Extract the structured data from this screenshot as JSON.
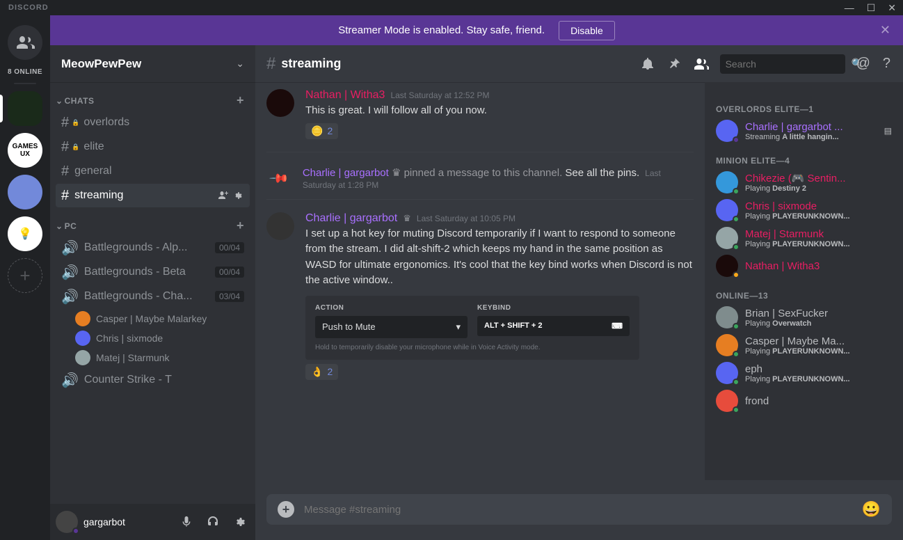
{
  "titlebar": {
    "brand": "DISCORD"
  },
  "guilds": {
    "online_label": "8 ONLINE"
  },
  "banner": {
    "text": "Streamer Mode is enabled. Stay safe, friend.",
    "button": "Disable"
  },
  "server": {
    "name": "MeowPewPew"
  },
  "categories": {
    "chats": {
      "label": "CHATS"
    },
    "pc": {
      "label": "PC"
    }
  },
  "channels": {
    "overlords": {
      "name": "overlords"
    },
    "elite": {
      "name": "elite"
    },
    "general": {
      "name": "general"
    },
    "streaming": {
      "name": "streaming"
    },
    "bg_alpha": {
      "name": "Battlegrounds - Alp...",
      "count": "00/04"
    },
    "bg_beta": {
      "name": "Battlegrounds - Beta",
      "count": "00/04"
    },
    "bg_cha": {
      "name": "Battlegrounds - Cha...",
      "count": "03/04"
    },
    "cs": {
      "name": "Counter Strike - T"
    }
  },
  "vc_users": [
    {
      "name": "Casper | Maybe Malarkey"
    },
    {
      "name": "Chris | sixmode"
    },
    {
      "name": "Matej | Starmunk"
    }
  ],
  "userbar": {
    "name": "gargarbot"
  },
  "topbar": {
    "channel": "streaming",
    "search_placeholder": "Search"
  },
  "messages": {
    "m1": {
      "author": "Nathan | Witha3",
      "ts": "Last Saturday at 12:52 PM",
      "text": "This is great. I will follow all of you now.",
      "react_emoji": "🪙",
      "react_count": "2"
    },
    "pin": {
      "author": "Charlie | gargarbot",
      "text": " pinned a message to this channel. ",
      "link": "See all the pins.",
      "ts": "Last Saturday at 1:28 PM"
    },
    "m2": {
      "author": "Charlie | gargarbot",
      "ts": "Last Saturday at 10:05 PM",
      "text": "I set up a hot key for muting Discord temporarily if I want to respond to someone from the stream. I did alt-shift-2 which keeps my hand in the same position as WASD for ultimate ergonomics. It's cool that the key bind works when Discord is not the active window..",
      "react_emoji": "👌",
      "react_count": "2"
    }
  },
  "embed": {
    "action_label": "ACTION",
    "action_value": "Push to Mute",
    "keybind_label": "KEYBIND",
    "keybind_value": "ALT + SHIFT + 2",
    "hint": "Hold to temporarily disable your microphone while in Voice Activity mode."
  },
  "composer": {
    "placeholder": "Message #streaming"
  },
  "roles": {
    "overlords": {
      "header": "OVERLORDS ELITE—1"
    },
    "minion": {
      "header": "MINION ELITE—4"
    },
    "online": {
      "header": "ONLINE—13"
    }
  },
  "members": {
    "charlie": {
      "name": "Charlie | gargarbot ...",
      "activity_pre": "Streaming ",
      "activity": "A little hangin..."
    },
    "chikezie": {
      "name": "Chikezie (🎮 Sentin...",
      "activity_pre": "Playing ",
      "activity": "Destiny 2"
    },
    "chris": {
      "name": "Chris | sixmode",
      "activity_pre": "Playing ",
      "activity": "PLAYERUNKNOWN..."
    },
    "matej": {
      "name": "Matej | Starmunk",
      "activity_pre": "Playing ",
      "activity": "PLAYERUNKNOWN..."
    },
    "nathan": {
      "name": "Nathan | Witha3"
    },
    "brian": {
      "name": "Brian | SexFucker",
      "activity_pre": "Playing ",
      "activity": "Overwatch"
    },
    "casper": {
      "name": "Casper | Maybe Ma...",
      "activity_pre": "Playing ",
      "activity": "PLAYERUNKNOWN..."
    },
    "eph": {
      "name": "eph",
      "activity_pre": "Playing ",
      "activity": "PLAYERUNKNOWN..."
    },
    "frond": {
      "name": "frond"
    }
  }
}
